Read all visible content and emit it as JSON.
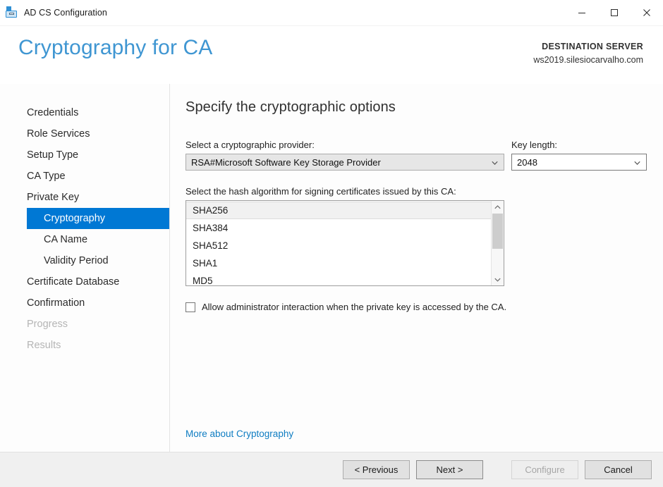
{
  "window": {
    "title": "AD CS Configuration",
    "icon": "toolbox-icon",
    "controls": {
      "minimize": "minimize-icon",
      "maximize": "maximize-icon",
      "close": "close-icon"
    }
  },
  "header": {
    "page_title": "Cryptography for CA",
    "destination_label": "DESTINATION SERVER",
    "destination_server": "ws2019.silesiocarvalho.com"
  },
  "sidebar": {
    "items": [
      {
        "label": "Credentials",
        "level": 0,
        "state": "normal"
      },
      {
        "label": "Role Services",
        "level": 0,
        "state": "normal"
      },
      {
        "label": "Setup Type",
        "level": 0,
        "state": "normal"
      },
      {
        "label": "CA Type",
        "level": 0,
        "state": "normal"
      },
      {
        "label": "Private Key",
        "level": 0,
        "state": "normal"
      },
      {
        "label": "Cryptography",
        "level": 1,
        "state": "selected"
      },
      {
        "label": "CA Name",
        "level": 1,
        "state": "normal"
      },
      {
        "label": "Validity Period",
        "level": 1,
        "state": "normal"
      },
      {
        "label": "Certificate Database",
        "level": 0,
        "state": "normal"
      },
      {
        "label": "Confirmation",
        "level": 0,
        "state": "normal"
      },
      {
        "label": "Progress",
        "level": 0,
        "state": "disabled"
      },
      {
        "label": "Results",
        "level": 0,
        "state": "disabled"
      }
    ]
  },
  "main": {
    "heading": "Specify the cryptographic options",
    "provider": {
      "label": "Select a cryptographic provider:",
      "value": "RSA#Microsoft Software Key Storage Provider"
    },
    "key_length": {
      "label": "Key length:",
      "value": "2048"
    },
    "hash": {
      "label": "Select the hash algorithm for signing certificates issued by this CA:",
      "selected": "SHA256",
      "options": [
        "SHA256",
        "SHA384",
        "SHA512",
        "SHA1",
        "MD5"
      ]
    },
    "allow_interaction": {
      "label": "Allow administrator interaction when the private key is accessed by the CA.",
      "checked": false
    },
    "more_link": "More about Cryptography"
  },
  "footer": {
    "previous": "< Previous",
    "next": "Next >",
    "configure": "Configure",
    "cancel": "Cancel",
    "configure_enabled": false
  },
  "colors": {
    "accent": "#3f96d2",
    "selection": "#0078d4",
    "link": "#0f7dc2",
    "footer_bg": "#f0f0f0"
  }
}
